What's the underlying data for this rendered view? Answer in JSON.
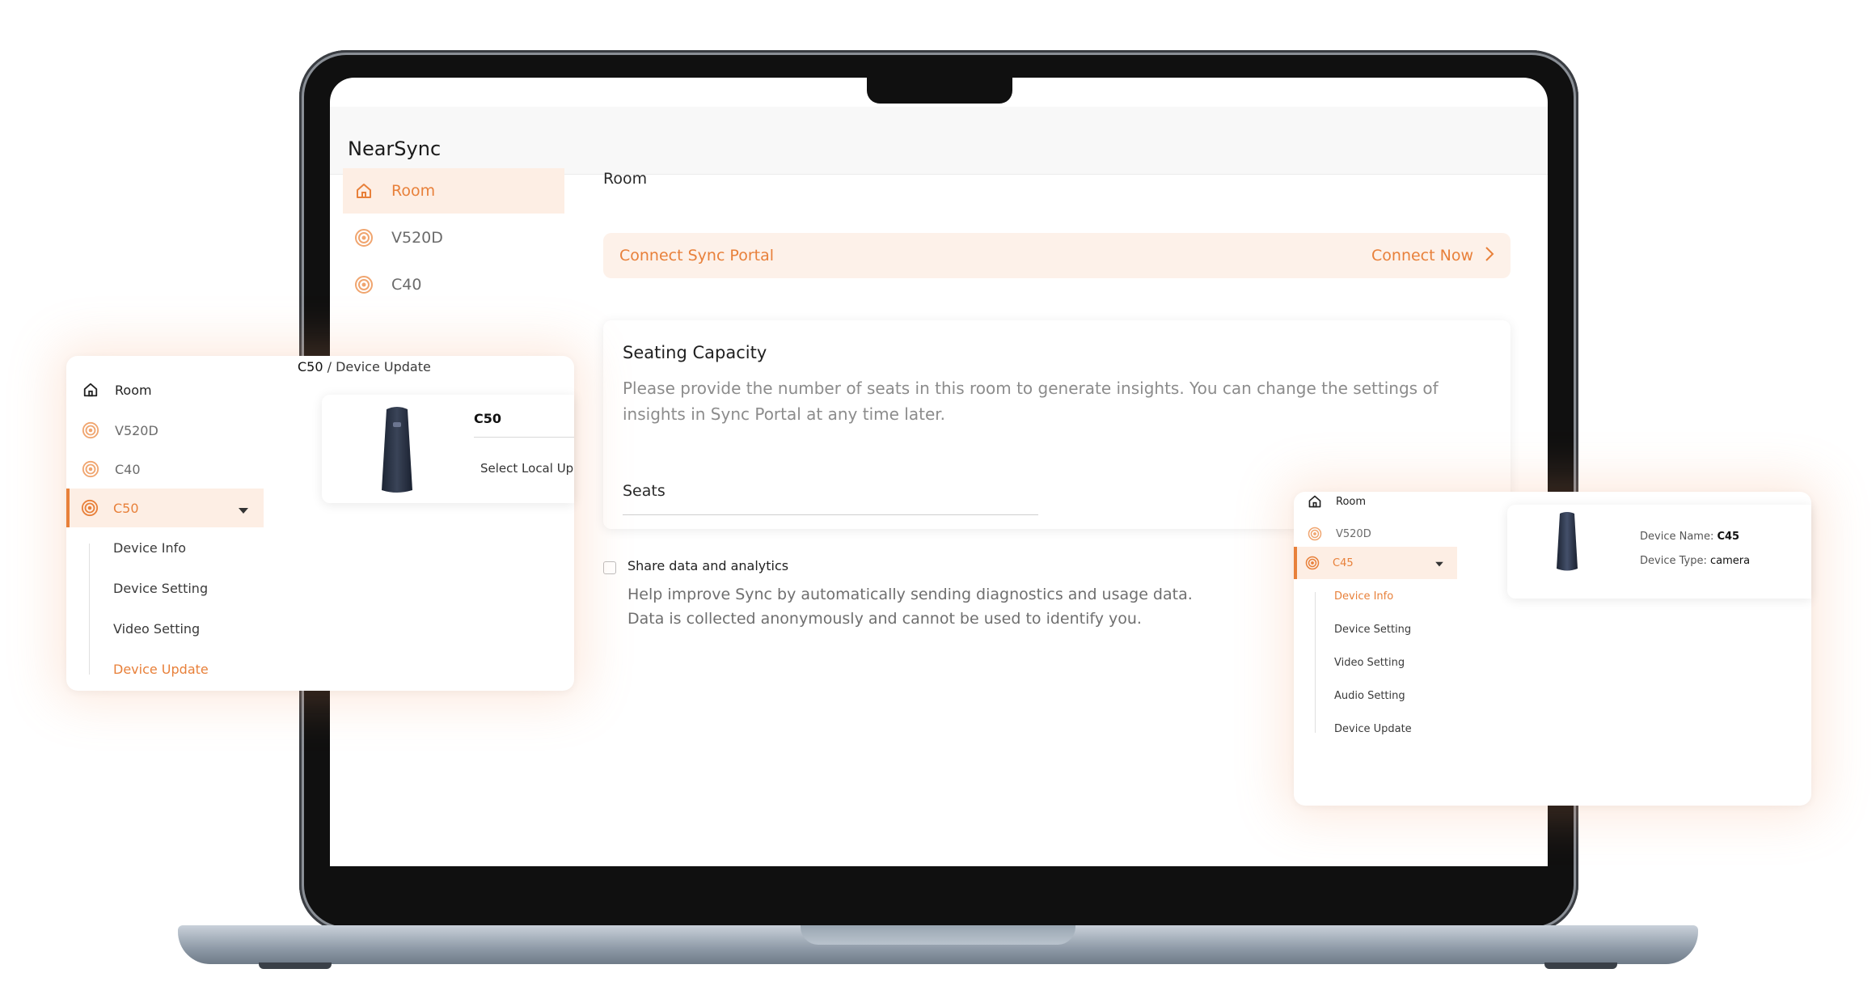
{
  "app": {
    "title": "NearSync"
  },
  "sidebar": {
    "items": [
      {
        "label": "Room",
        "icon": "home-icon",
        "active": true
      },
      {
        "label": "V520D",
        "icon": "device-signal-icon",
        "active": false
      },
      {
        "label": "C40",
        "icon": "device-signal-icon",
        "active": false
      }
    ]
  },
  "main": {
    "breadcrumb": "Room",
    "connect": {
      "label": "Connect Sync Portal",
      "action": "Connect Now"
    },
    "seating": {
      "title": "Seating Capacity",
      "description": "Please provide the number of seats in this room to generate insights. You can change the settings of insights in Sync Portal at any time later.",
      "seats_label": "Seats"
    },
    "share": {
      "label": "Share data and analytics",
      "line1": "Help improve Sync by automatically sending diagnostics and usage data.",
      "line2": "Data is collected anonymously and cannot be used to identify you.",
      "checked": false
    }
  },
  "left_card": {
    "breadcrumb_device": "C50",
    "breadcrumb_rest": " / Device Update",
    "nav": [
      "Room",
      "V520D",
      "C40"
    ],
    "active_device": "C50",
    "sub_items": [
      "Device Info",
      "Device Setting",
      "Video Setting",
      "Device Update"
    ],
    "active_sub": "Device Update",
    "device_name": "C50",
    "upload_label": "Select Local Upg"
  },
  "right_card": {
    "nav": [
      "Room",
      "V520D"
    ],
    "active_device": "C45",
    "sub_items": [
      "Device Info",
      "Device Setting",
      "Video Setting",
      "Audio Setting",
      "Device Update"
    ],
    "active_sub": "Device Info",
    "device_name_label": "Device Name: ",
    "device_name": "C45",
    "device_type_label": "Device Type: ",
    "device_type": "camera"
  },
  "colors": {
    "accent": "#e8803a",
    "accent_bg": "#fdeee4"
  }
}
